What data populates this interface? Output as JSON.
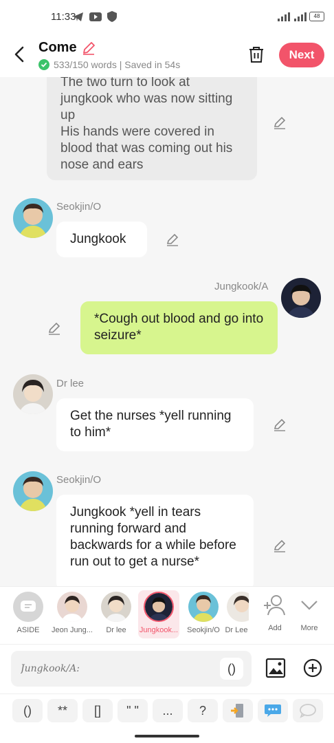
{
  "status": {
    "time": "11:33",
    "battery": "48"
  },
  "header": {
    "title": "Come",
    "words": "533/150 words | Saved in 54s",
    "next_label": "Next"
  },
  "messages": {
    "m0": {
      "text": "The two turn to look at jungkook who was now sitting up\nHis hands were covered in blood that was coming out his nose and ears"
    },
    "m1": {
      "name": "Seokjin/O",
      "text": "Jungkook"
    },
    "m2": {
      "name": "Jungkook/A",
      "text": "*Cough out blood and go into seizure*"
    },
    "m3": {
      "name": "Dr lee",
      "text": "Get the nurses *yell running to him*"
    },
    "m4": {
      "name": "Seokjin/O",
      "text": "Jungkook *yell in tears running forward and backwards for a while before run out to get a nurse*"
    }
  },
  "characters": [
    {
      "label": "ASIDE"
    },
    {
      "label": "Jeon Jung..."
    },
    {
      "label": "Dr lee"
    },
    {
      "label": "Jungkook..."
    },
    {
      "label": "Seokjin/O"
    },
    {
      "label": "Dr Lee"
    },
    {
      "label": "Add"
    },
    {
      "label": "More"
    }
  ],
  "input": {
    "placeholder": "Jungkook/A:",
    "paren": "()"
  },
  "keys": [
    "()",
    "**",
    "[]",
    "\" \"",
    "...",
    "?"
  ],
  "colors": {
    "accent": "#f2546a",
    "green_bubble": "#d7f58e"
  }
}
